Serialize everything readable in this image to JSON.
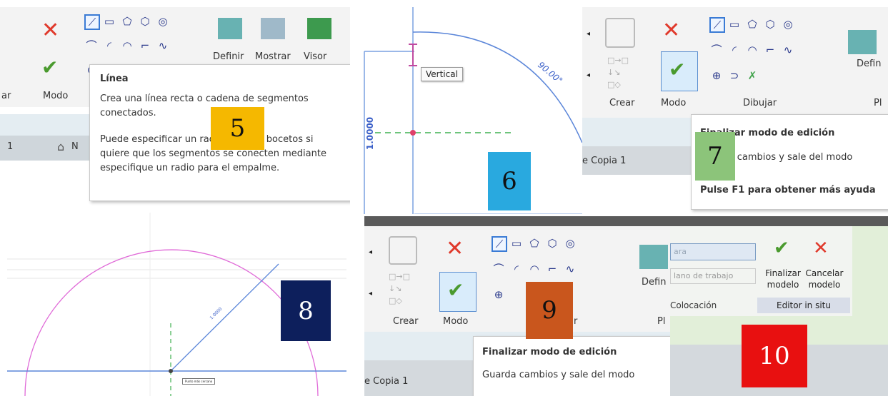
{
  "panel5": {
    "tool_label_fragment1": "Definir",
    "tool_label_fragment2": "Mostrar",
    "tool_label_fragment3": "Visor",
    "left_fragment": "ar",
    "modo_label": "Modo",
    "tab_left": "1",
    "tab_fragment": "N",
    "tooltip_title": "Línea",
    "tooltip_line1": "Crea una línea recta o cadena de segmentos",
    "tooltip_line2": "conectados.",
    "tooltip_line3": "Puede especificar un radio para los bocetos si",
    "tooltip_line4": "quiere que los segmentos se conecten mediante",
    "tooltip_line5": "especifique un radio para el empalme.",
    "badge": "5",
    "badge_color": "#f5b800"
  },
  "panel6": {
    "vertical_tooltip": "Vertical",
    "angle_label": "90.00°",
    "dimension_label": "1.0000",
    "badge": "6",
    "badge_color": "#29a9df"
  },
  "panel7": {
    "crear_label": "Crear",
    "modo_label": "Modo",
    "dibujar_label": "Dibujar",
    "p_fragment": "Pl",
    "defin_fragment": "Defin",
    "copia_label": "e Copia 1",
    "tooltip_title": "Finalizar modo de edición",
    "tooltip_line1": "Guarda cambios y sale del modo",
    "tooltip_help": "Pulse F1 para obtener más ayuda",
    "badge": "7",
    "badge_color": "#8cc47a"
  },
  "panel8": {
    "radius_label": "1.0000",
    "endpoint_label": "Punto más cercano",
    "badge": "8",
    "badge_color": "#0d1f5c"
  },
  "panel9": {
    "crear_label": "Crear",
    "modo_label": "Modo",
    "dibujar_fragment": "ar",
    "p_fragment": "Pl",
    "defin_fragment": "Defin",
    "copia_label": "e Copia 1",
    "tooltip_title": "Finalizar modo de edición",
    "tooltip_line1": "Guarda cambios y sale del modo",
    "badge": "9",
    "badge_color": "#c9561d"
  },
  "panel10": {
    "input_value": "ara",
    "plane_label": "lano de trabajo",
    "finish_label_1": "Finalizar",
    "finish_label_2": "modelo",
    "cancel_label_1": "Cancelar",
    "cancel_label_2": "modelo",
    "colocacion_label": "Colocación",
    "editor_label": "Editor in situ",
    "badge": "10",
    "badge_color": "#e81010"
  }
}
